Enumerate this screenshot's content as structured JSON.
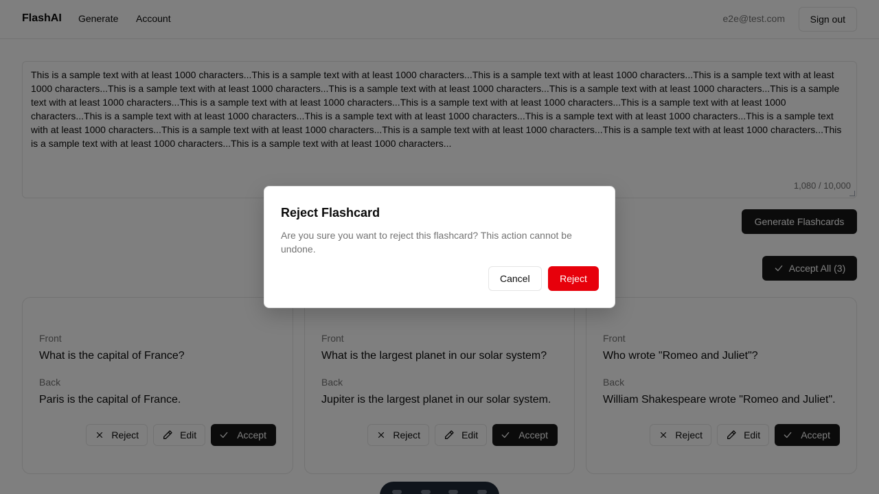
{
  "header": {
    "brand": "FlashAI",
    "nav": [
      "Generate",
      "Account"
    ],
    "user_email": "e2e@test.com",
    "sign_out_label": "Sign out"
  },
  "source_input": {
    "text": "This is a sample text with at least 1000 characters...This is a sample text with at least 1000 characters...This is a sample text with at least 1000 characters...This is a sample text with at least 1000 characters...This is a sample text with at least 1000 characters...This is a sample text with at least 1000 characters...This is a sample text with at least 1000 characters...This is a sample text with at least 1000 characters...This is a sample text with at least 1000 characters...This is a sample text with at least 1000 characters...This is a sample text with at least 1000 characters...This is a sample text with at least 1000 characters...This is a sample text with at least 1000 characters...This is a sample text with at least 1000 characters...This is a sample text with at least 1000 characters...This is a sample text with at least 1000 characters...This is a sample text with at least 1000 characters...This is a sample text with at least 1000 characters...This is a sample text with at least 1000 characters...This is a sample text with at least 1000 characters...",
    "char_count": "1,080 / 10,000"
  },
  "generate_button_label": "Generate Flashcards",
  "accept_all_label": "Accept All (3)",
  "card_labels": {
    "front": "Front",
    "back": "Back",
    "reject": "Reject",
    "edit": "Edit",
    "accept": "Accept"
  },
  "cards": [
    {
      "front": "What is the capital of France?",
      "back": "Paris is the capital of France."
    },
    {
      "front": "What is the largest planet in our solar system?",
      "back": "Jupiter is the largest planet in our solar system."
    },
    {
      "front": "Who wrote \"Romeo and Juliet\"?",
      "back": "William Shakespeare wrote \"Romeo and Juliet\"."
    }
  ],
  "dialog": {
    "title": "Reject Flashcard",
    "description": "Are you sure you want to reject this flashcard? This action cannot be undone.",
    "cancel_label": "Cancel",
    "reject_label": "Reject"
  },
  "colors": {
    "primary": "#171717",
    "destructive": "#e7000b",
    "muted_text": "#737373",
    "border": "#e5e5e5"
  }
}
